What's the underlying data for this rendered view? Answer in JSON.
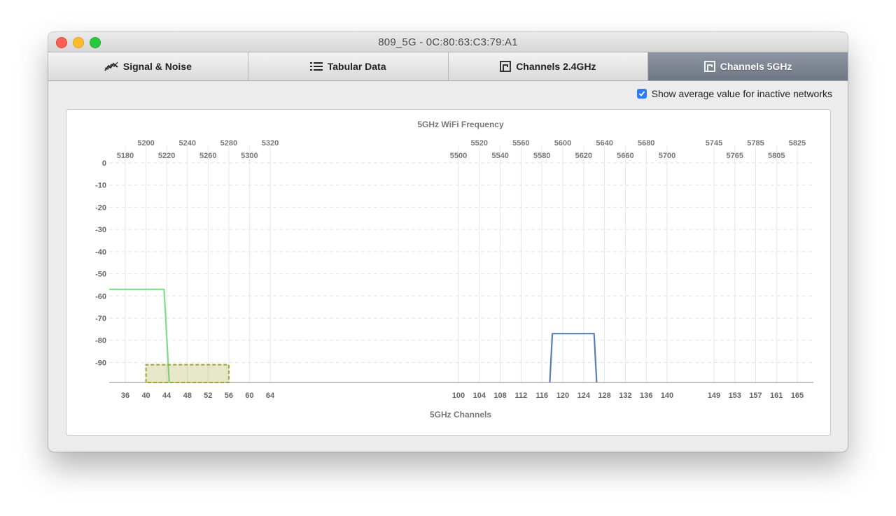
{
  "window": {
    "title": "809_5G - 0C:80:63:C3:79:A1"
  },
  "tabs": [
    {
      "label": "Signal & Noise",
      "icon": "signal-noise-icon"
    },
    {
      "label": "Tabular Data",
      "icon": "list-icon"
    },
    {
      "label": "Channels 2.4GHz",
      "icon": "channels-icon"
    },
    {
      "label": "Channels 5GHz",
      "icon": "channels-icon",
      "active": true
    }
  ],
  "options": {
    "show_average_label": "Show average value for inactive networks",
    "show_average_checked": true
  },
  "colors": {
    "accent": "#2f7cf6",
    "active_tab": "#7a8190",
    "series_green": "#7fdc8c",
    "series_blue": "#5b7db3",
    "series_olive": "#9fa12a"
  },
  "chart_data": {
    "type": "line",
    "title": "5GHz WiFi Frequency",
    "xlabel": "5GHz Channels",
    "ylabel": "",
    "ylim": [
      -99,
      0
    ],
    "y_ticks": [
      0,
      -10,
      -20,
      -30,
      -40,
      -50,
      -60,
      -70,
      -80,
      -90
    ],
    "grid": true,
    "channels": [
      36,
      40,
      44,
      48,
      52,
      56,
      60,
      64,
      100,
      104,
      108,
      112,
      116,
      120,
      124,
      128,
      132,
      136,
      140,
      149,
      153,
      157,
      161,
      165
    ],
    "freq_top_row": [
      {
        "label": "5200",
        "channel": 40
      },
      {
        "label": "5240",
        "channel": 48
      },
      {
        "label": "5280",
        "channel": 56
      },
      {
        "label": "5320",
        "channel": 64
      },
      {
        "label": "5520",
        "channel": 104
      },
      {
        "label": "5560",
        "channel": 112
      },
      {
        "label": "5600",
        "channel": 120
      },
      {
        "label": "5640",
        "channel": 128
      },
      {
        "label": "5680",
        "channel": 136
      },
      {
        "label": "5745",
        "channel": 149
      },
      {
        "label": "5785",
        "channel": 157
      },
      {
        "label": "5825",
        "channel": 165
      }
    ],
    "freq_bottom_row": [
      {
        "label": "5180",
        "channel": 36
      },
      {
        "label": "5220",
        "channel": 44
      },
      {
        "label": "5260",
        "channel": 52
      },
      {
        "label": "5300",
        "channel": 60
      },
      {
        "label": "5500",
        "channel": 100
      },
      {
        "label": "5540",
        "channel": 108
      },
      {
        "label": "5580",
        "channel": 116
      },
      {
        "label": "5620",
        "channel": 124
      },
      {
        "label": "5660",
        "channel": 132
      },
      {
        "label": "5700",
        "channel": 140
      },
      {
        "label": "5765",
        "channel": 153
      },
      {
        "label": "5805",
        "channel": 161
      }
    ],
    "series": [
      {
        "color": "#7fdc8c",
        "style": "solid",
        "fill": false,
        "points": [
          [
            32.5,
            -57
          ],
          [
            43.5,
            -57
          ],
          [
            44.5,
            -99
          ]
        ]
      },
      {
        "color": "#9fa12a",
        "style": "dashed",
        "fill": true,
        "points": [
          [
            40,
            -99
          ],
          [
            40,
            -91
          ],
          [
            56,
            -91
          ],
          [
            56,
            -99
          ]
        ]
      },
      {
        "color": "#5b7db3",
        "style": "solid",
        "fill": false,
        "points": [
          [
            117.5,
            -99
          ],
          [
            118,
            -77
          ],
          [
            126,
            -77
          ],
          [
            126.5,
            -99
          ]
        ]
      }
    ]
  }
}
